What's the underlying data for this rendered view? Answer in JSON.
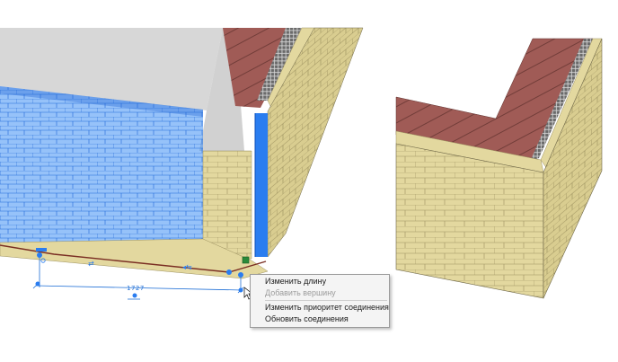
{
  "dimension": {
    "value": "1727"
  },
  "context_menu": {
    "items": [
      {
        "label": "Изменить длину",
        "enabled": true
      },
      {
        "label": "Добавить вершину",
        "enabled": false
      },
      {
        "label": "Изменить приоритет соединения",
        "enabled": true
      },
      {
        "label": "Обновить соединения",
        "enabled": true
      }
    ]
  },
  "colors": {
    "brick": "#e2d79c",
    "insulation": "#4a4a4a",
    "roof": "#9e5a55",
    "selection": "#2a7df0",
    "dimension": "#1f6fd6"
  }
}
